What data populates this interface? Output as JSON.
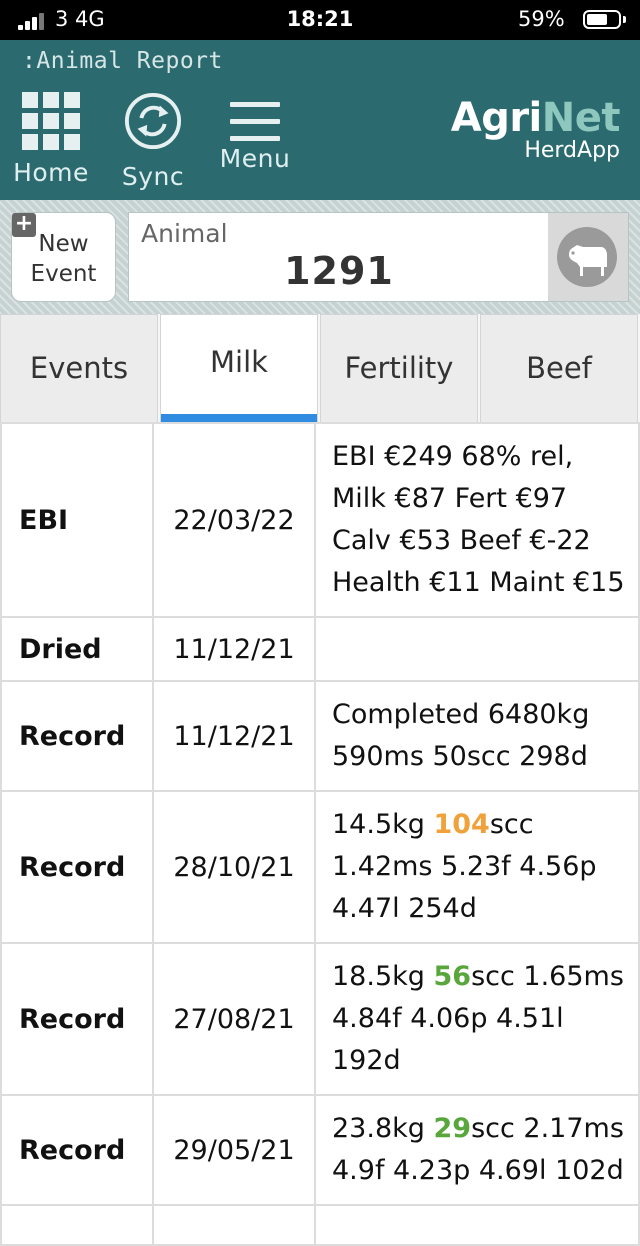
{
  "status_bar": {
    "carrier": "3  4G",
    "time": "18:21",
    "battery_percent": "59%",
    "battery_level": 0.59
  },
  "header": {
    "page_title": ":Animal Report",
    "nav": {
      "home": "Home",
      "sync": "Sync",
      "menu": "Menu"
    },
    "brand": {
      "agri": "Agri",
      "net": "Net",
      "sub": "HerdApp"
    },
    "colors": {
      "header_bg": "#2b6b70",
      "brand_accent": "#8ec7bd",
      "tab_accent": "#2f8ce0"
    }
  },
  "event_bar": {
    "new_event_line1": "New",
    "new_event_line2": "Event",
    "animal_label": "Animal",
    "animal_value": "1291",
    "animal_icon": "cow-icon"
  },
  "tabs": [
    {
      "label": "Events"
    },
    {
      "label": "Milk",
      "active": true
    },
    {
      "label": "Fertility"
    },
    {
      "label": "Beef"
    }
  ],
  "rows": [
    {
      "type": "EBI",
      "date": "22/03/22",
      "p1": "EBI €249 68% rel, Milk €87 Fert €97 Calv €53 Beef €-22 Health €11 Maint €15",
      "hl": "",
      "p2": "",
      "hl_color": ""
    },
    {
      "type": "Dried",
      "date": "11/12/21",
      "p1": "",
      "hl": "",
      "p2": "",
      "hl_color": ""
    },
    {
      "type": "Record",
      "date": "11/12/21",
      "p1": "Completed 6480kg 590ms 50scc 298d",
      "hl": "",
      "p2": "",
      "hl_color": ""
    },
    {
      "type": "Record",
      "date": "28/10/21",
      "p1": "14.5kg ",
      "hl": "104",
      "p2": "scc 1.42ms 5.23f 4.56p 4.47l 254d",
      "hl_color": "orange"
    },
    {
      "type": "Record",
      "date": "27/08/21",
      "p1": "18.5kg ",
      "hl": "56",
      "p2": "scc 1.65ms 4.84f 4.06p 4.51l 192d",
      "hl_color": "green"
    },
    {
      "type": "Record",
      "date": "29/05/21",
      "p1": "23.8kg ",
      "hl": "29",
      "p2": "scc 2.17ms 4.9f 4.23p 4.69l 102d",
      "hl_color": "green"
    }
  ]
}
